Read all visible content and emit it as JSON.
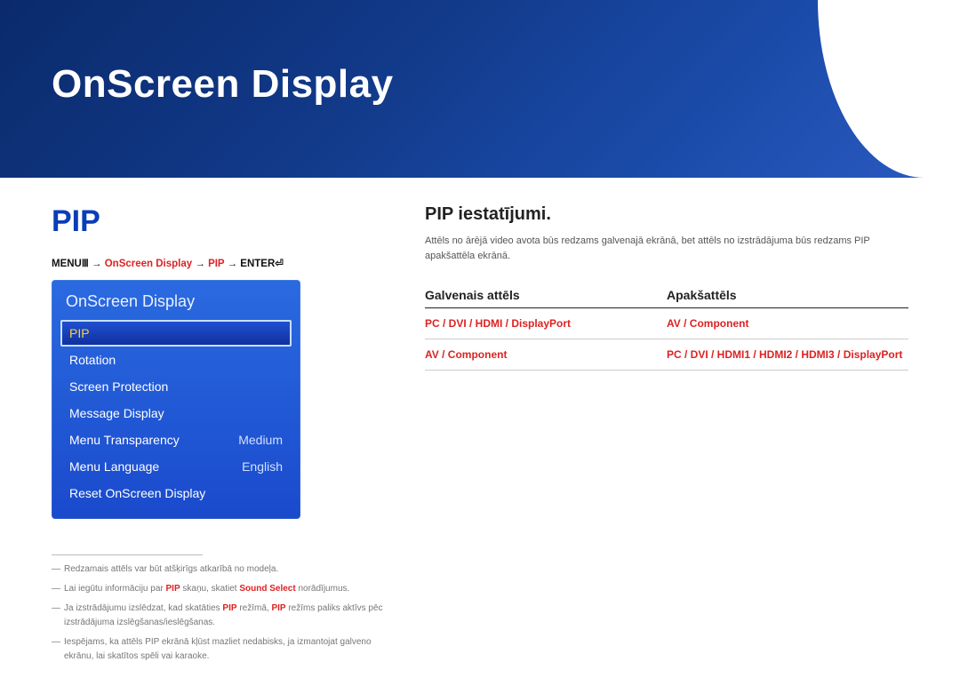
{
  "banner": {
    "title": "OnScreen Display"
  },
  "left": {
    "heading": "PIP",
    "breadcrumb": {
      "pre": "MENU",
      "glyph1": "Ⅲ",
      "arrow": "→",
      "part_hl1": "OnScreen Display",
      "part_hl2": "PIP",
      "post": "ENTER",
      "glyph2": "⏎"
    },
    "menu_title": "OnScreen Display",
    "items": [
      {
        "label": "PIP",
        "value": "",
        "selected": true
      },
      {
        "label": "Rotation",
        "value": ""
      },
      {
        "label": "Screen Protection",
        "value": ""
      },
      {
        "label": "Message Display",
        "value": ""
      },
      {
        "label": "Menu Transparency",
        "value": "Medium"
      },
      {
        "label": "Menu Language",
        "value": "English"
      },
      {
        "label": "Reset OnScreen Display",
        "value": ""
      }
    ],
    "footnotes": {
      "n1": "Redzamais attēls var būt atšķirīgs atkarībā no modeļa.",
      "n2a": "Lai iegūtu informāciju par ",
      "n2b": " skaņu, skatiet ",
      "n2c": " norādījumus.",
      "n2_pip": "PIP",
      "n2_ss": "Sound Select",
      "n3a": "Ja izstrādājumu izslēdzat, kad skatāties ",
      "n3_pip1": "PIP",
      "n3b": " režīmā, ",
      "n3_pip2": "PIP",
      "n3c": " režīms paliks aktīvs pēc izstrādājuma izslēgšanas/ieslēgšanas.",
      "n4": "Iespējams, ka attēls PIP ekrānā kļūst mazliet nedabisks, ja izmantojat galveno ekrānu, lai skatītos spēli vai karaoke."
    }
  },
  "right": {
    "heading": "PIP iestatījumi.",
    "desc": "Attēls no ārējā video avota būs redzams galvenajā ekrānā, bet attēls no izstrādājuma būs redzams PIP apakšattēla ekrānā.",
    "th1": "Galvenais attēls",
    "th2": "Apakšattēls",
    "rows": [
      {
        "c1": "PC / DVI / HDMI / DisplayPort",
        "c2": "AV / Component"
      },
      {
        "c1": "AV / Component",
        "c2": "PC / DVI / HDMI1 / HDMI2 / HDMI3 / DisplayPort"
      }
    ]
  }
}
